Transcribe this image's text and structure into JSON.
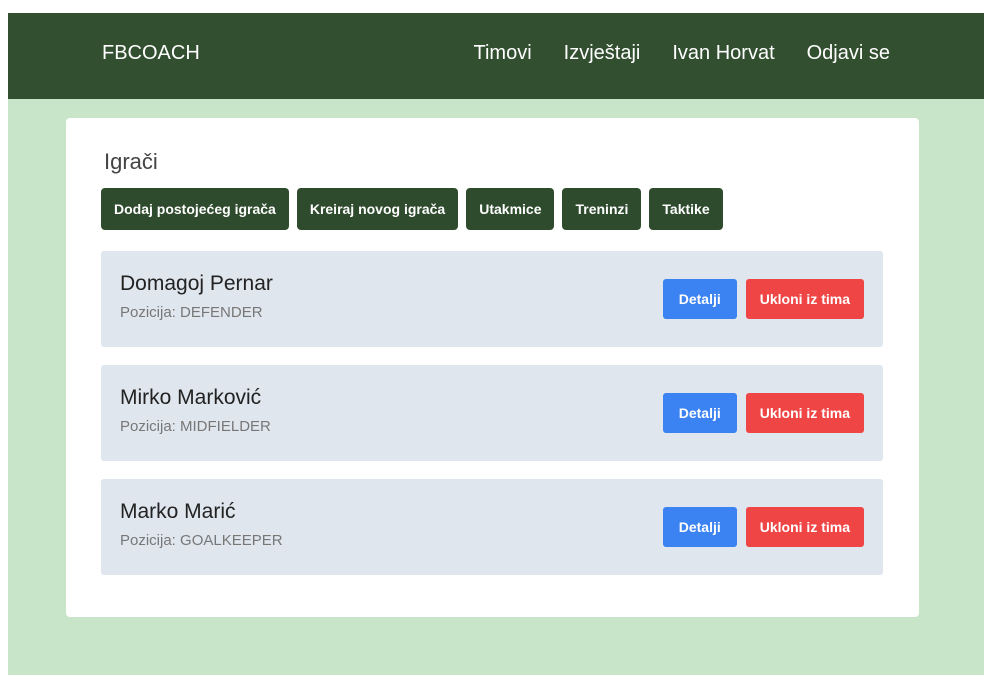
{
  "navbar": {
    "brand": "FBCOACH",
    "links": [
      {
        "label": "Timovi"
      },
      {
        "label": "Izvještaji"
      },
      {
        "label": "Ivan Horvat"
      },
      {
        "label": "Odjavi se"
      }
    ]
  },
  "main": {
    "title": "Igrači",
    "actions": [
      {
        "label": "Dodaj postojećeg igrača"
      },
      {
        "label": "Kreiraj novog igrača"
      },
      {
        "label": "Utakmice"
      },
      {
        "label": "Treninzi"
      },
      {
        "label": "Taktike"
      }
    ],
    "players": [
      {
        "name": "Domagoj Pernar",
        "position": "Pozicija: DEFENDER",
        "details_label": "Detalji",
        "remove_label": "Ukloni iz tima"
      },
      {
        "name": "Mirko Marković",
        "position": "Pozicija: MIDFIELDER",
        "details_label": "Detalji",
        "remove_label": "Ukloni iz tima"
      },
      {
        "name": "Marko Marić",
        "position": "Pozicija: GOALKEEPER",
        "details_label": "Detalji",
        "remove_label": "Ukloni iz tima"
      }
    ]
  },
  "colors": {
    "navbar_bg": "#324f30",
    "page_bg": "#c9e5c9",
    "card_bg": "#ffffff",
    "row_bg": "#e0e6ee",
    "dark_button": "#2f4b2d",
    "primary_button": "#3b82f2",
    "danger_button": "#ef4545"
  }
}
